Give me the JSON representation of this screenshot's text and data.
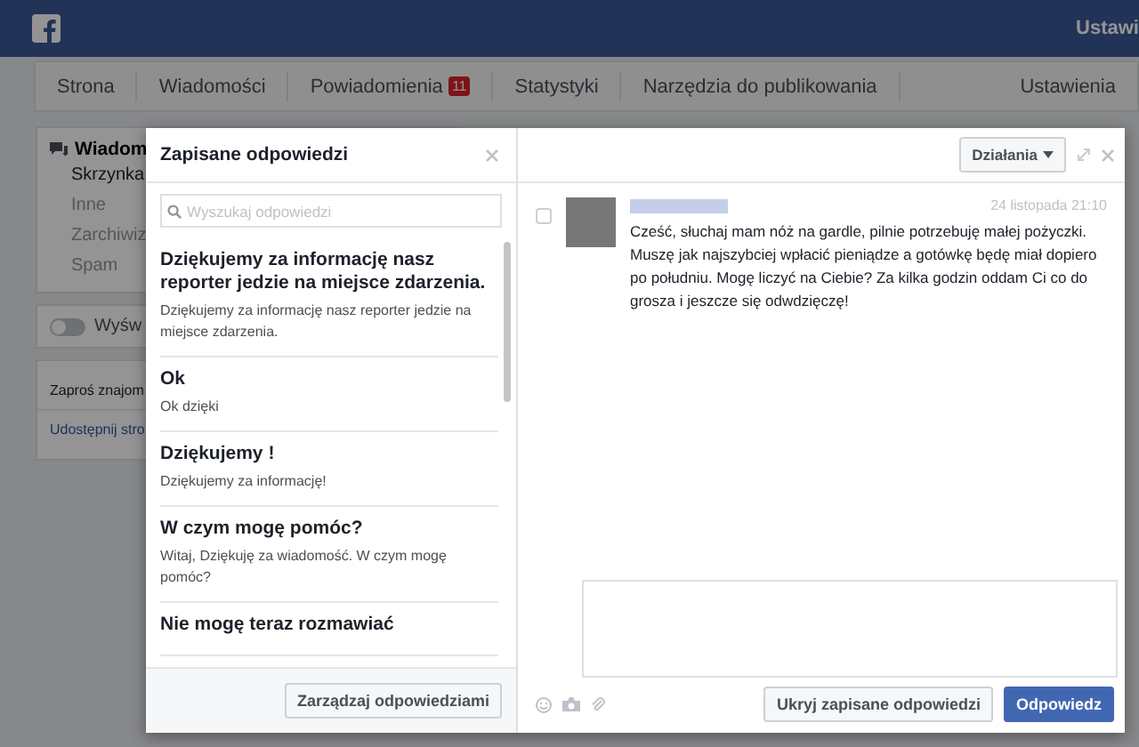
{
  "topbar": {
    "settings_label": "Ustawi"
  },
  "nav": {
    "tabs": [
      {
        "label": "Strona",
        "selected": false
      },
      {
        "label": "Wiadomości",
        "selected": false
      },
      {
        "label": "Powiadomienia",
        "selected": false,
        "badge": "11"
      },
      {
        "label": "Statystyki",
        "selected": false
      },
      {
        "label": "Narzędzia do publikowania",
        "selected": false
      }
    ],
    "settings": "Ustawienia"
  },
  "sidebar": {
    "title": "Wiadom",
    "items": [
      {
        "label": "Skrzynka",
        "selected": true
      },
      {
        "label": "Inne",
        "selected": false
      },
      {
        "label": "Zarchiwiz",
        "selected": false
      },
      {
        "label": "Spam",
        "selected": false
      }
    ],
    "toggle": {
      "label": "Wyśw",
      "on": false
    },
    "invite": "Zaproś znajom",
    "share_link": "Udostępnij stro"
  },
  "saved_replies": {
    "title": "Zapisane odpowiedzi",
    "search": {
      "placeholder": "Wyszukaj odpowiedzi"
    },
    "replies": [
      {
        "title": "Dziękujemy za informację nasz reporter jedzie na miejsce zdarzenia.",
        "body": "Dziękujemy za informację nasz reporter jedzie na miejsce zdarzenia."
      },
      {
        "title": "Ok",
        "body": "Ok dzięki"
      },
      {
        "title": "Dziękujemy !",
        "body": "Dziękujemy za informację!"
      },
      {
        "title": "W czym mogę pomóc?",
        "body": "Witaj, Dziękuję za wiadomość. W czym mogę pomóc?"
      },
      {
        "title": "Nie mogę teraz rozmawiać"
      }
    ],
    "manage_button": "Zarządzaj odpowiedziami"
  },
  "conversation": {
    "actions_button": "Działania",
    "message": {
      "checked": false,
      "time": "24 listopada 21:10",
      "text": "Cześć, słuchaj mam nóż na gardle, pilnie potrzebuję małej pożyczki. Muszę jak najszybciej wpłacić pieniądze a gotówkę będę miał dopiero po południu. Mogę liczyć na Ciebie? Za kilka godzin oddam Ci co do grosza i jeszcze się odwdzięczę!"
    },
    "hide_button": "Ukryj zapisane odpowiedzi",
    "send_button": "Odpowiedz"
  }
}
